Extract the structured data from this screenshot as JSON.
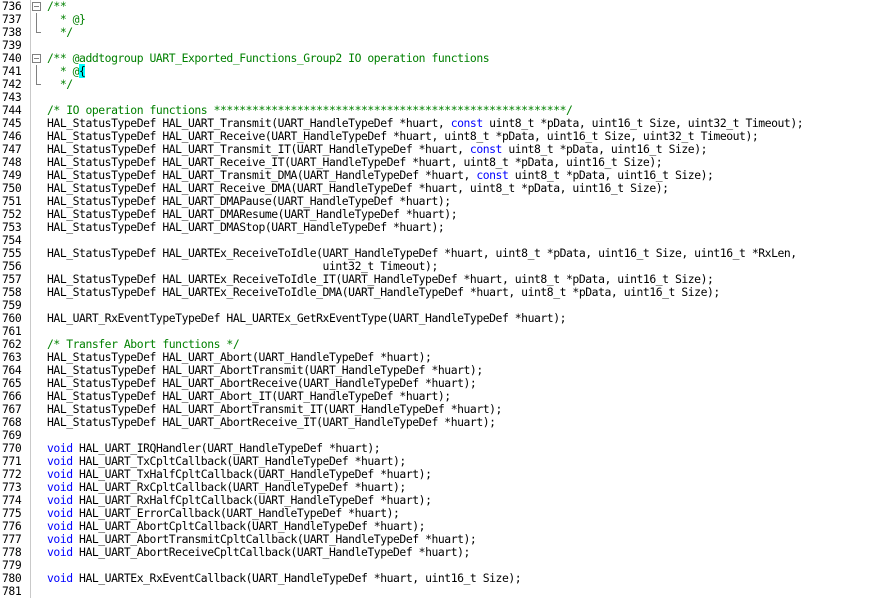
{
  "editor": {
    "lines": [
      {
        "n": "736",
        "fold": "start",
        "segs": [
          {
            "t": "/**",
            "c": "cmt"
          }
        ]
      },
      {
        "n": "737",
        "fold": "line",
        "segs": [
          {
            "t": "  * @}",
            "c": "cmt"
          }
        ]
      },
      {
        "n": "738",
        "fold": "end",
        "segs": [
          {
            "t": "  */",
            "c": "cmt"
          }
        ]
      },
      {
        "n": "739",
        "fold": "",
        "segs": []
      },
      {
        "n": "740",
        "fold": "start",
        "segs": [
          {
            "t": "/** @addtogroup UART_Exported_Functions_Group2 IO operation functions",
            "c": "cmt"
          }
        ]
      },
      {
        "n": "741",
        "fold": "line",
        "segs": [
          {
            "t": "  * @",
            "c": "cmt"
          },
          {
            "t": "{",
            "c": "cur"
          }
        ]
      },
      {
        "n": "742",
        "fold": "end",
        "segs": [
          {
            "t": "  */",
            "c": "cmt"
          }
        ]
      },
      {
        "n": "743",
        "fold": "",
        "segs": []
      },
      {
        "n": "744",
        "fold": "",
        "segs": [
          {
            "t": "/* IO operation functions *******************************************************/",
            "c": "cmt"
          }
        ]
      },
      {
        "n": "745",
        "fold": "",
        "segs": [
          {
            "t": "HAL_StatusTypeDef HAL_UART_Transmit(UART_HandleTypeDef *huart, ",
            "c": ""
          },
          {
            "t": "const",
            "c": "kw"
          },
          {
            "t": " uint8_t *pData, uint16_t Size, uint32_t Timeout);",
            "c": ""
          }
        ]
      },
      {
        "n": "746",
        "fold": "",
        "segs": [
          {
            "t": "HAL_StatusTypeDef HAL_UART_Receive(UART_HandleTypeDef *huart, uint8_t *pData, uint16_t Size, uint32_t Timeout);",
            "c": ""
          }
        ]
      },
      {
        "n": "747",
        "fold": "",
        "segs": [
          {
            "t": "HAL_StatusTypeDef HAL_UART_Transmit_IT(UART_HandleTypeDef *huart, ",
            "c": ""
          },
          {
            "t": "const",
            "c": "kw"
          },
          {
            "t": " uint8_t *pData, uint16_t Size);",
            "c": ""
          }
        ]
      },
      {
        "n": "748",
        "fold": "",
        "segs": [
          {
            "t": "HAL_StatusTypeDef HAL_UART_Receive_IT(UART_HandleTypeDef *huart, uint8_t *pData, uint16_t Size);",
            "c": ""
          }
        ]
      },
      {
        "n": "749",
        "fold": "",
        "segs": [
          {
            "t": "HAL_StatusTypeDef HAL_UART_Transmit_DMA(UART_HandleTypeDef *huart, ",
            "c": ""
          },
          {
            "t": "const",
            "c": "kw"
          },
          {
            "t": " uint8_t *pData, uint16_t Size);",
            "c": ""
          }
        ]
      },
      {
        "n": "750",
        "fold": "",
        "segs": [
          {
            "t": "HAL_StatusTypeDef HAL_UART_Receive_DMA(UART_HandleTypeDef *huart, uint8_t *pData, uint16_t Size);",
            "c": ""
          }
        ]
      },
      {
        "n": "751",
        "fold": "",
        "segs": [
          {
            "t": "HAL_StatusTypeDef HAL_UART_DMAPause(UART_HandleTypeDef *huart);",
            "c": ""
          }
        ]
      },
      {
        "n": "752",
        "fold": "",
        "segs": [
          {
            "t": "HAL_StatusTypeDef HAL_UART_DMAResume(UART_HandleTypeDef *huart);",
            "c": ""
          }
        ]
      },
      {
        "n": "753",
        "fold": "",
        "segs": [
          {
            "t": "HAL_StatusTypeDef HAL_UART_DMAStop(UART_HandleTypeDef *huart);",
            "c": ""
          }
        ]
      },
      {
        "n": "754",
        "fold": "",
        "segs": []
      },
      {
        "n": "755",
        "fold": "",
        "segs": [
          {
            "t": "HAL_StatusTypeDef HAL_UARTEx_ReceiveToIdle(UART_HandleTypeDef *huart, uint8_t *pData, uint16_t Size, uint16_t *RxLen,",
            "c": ""
          }
        ]
      },
      {
        "n": "756",
        "fold": "",
        "segs": [
          {
            "t": "                                           uint32_t Timeout);",
            "c": ""
          }
        ]
      },
      {
        "n": "757",
        "fold": "",
        "segs": [
          {
            "t": "HAL_StatusTypeDef HAL_UARTEx_ReceiveToIdle_IT(UART_HandleTypeDef *huart, uint8_t *pData, uint16_t Size);",
            "c": ""
          }
        ]
      },
      {
        "n": "758",
        "fold": "",
        "segs": [
          {
            "t": "HAL_StatusTypeDef HAL_UARTEx_ReceiveToIdle_DMA(UART_HandleTypeDef *huart, uint8_t *pData, uint16_t Size);",
            "c": ""
          }
        ]
      },
      {
        "n": "759",
        "fold": "",
        "segs": []
      },
      {
        "n": "760",
        "fold": "",
        "segs": [
          {
            "t": "HAL_UART_RxEventTypeTypeDef HAL_UARTEx_GetRxEventType(UART_HandleTypeDef *huart);",
            "c": ""
          }
        ]
      },
      {
        "n": "761",
        "fold": "",
        "segs": []
      },
      {
        "n": "762",
        "fold": "",
        "segs": [
          {
            "t": "/* Transfer Abort functions */",
            "c": "cmt"
          }
        ]
      },
      {
        "n": "763",
        "fold": "",
        "segs": [
          {
            "t": "HAL_StatusTypeDef HAL_UART_Abort(UART_HandleTypeDef *huart);",
            "c": ""
          }
        ]
      },
      {
        "n": "764",
        "fold": "",
        "segs": [
          {
            "t": "HAL_StatusTypeDef HAL_UART_AbortTransmit(UART_HandleTypeDef *huart);",
            "c": ""
          }
        ]
      },
      {
        "n": "765",
        "fold": "",
        "segs": [
          {
            "t": "HAL_StatusTypeDef HAL_UART_AbortReceive(UART_HandleTypeDef *huart);",
            "c": ""
          }
        ]
      },
      {
        "n": "766",
        "fold": "",
        "segs": [
          {
            "t": "HAL_StatusTypeDef HAL_UART_Abort_IT(UART_HandleTypeDef *huart);",
            "c": ""
          }
        ]
      },
      {
        "n": "767",
        "fold": "",
        "segs": [
          {
            "t": "HAL_StatusTypeDef HAL_UART_AbortTransmit_IT(UART_HandleTypeDef *huart);",
            "c": ""
          }
        ]
      },
      {
        "n": "768",
        "fold": "",
        "segs": [
          {
            "t": "HAL_StatusTypeDef HAL_UART_AbortReceive_IT(UART_HandleTypeDef *huart);",
            "c": ""
          }
        ]
      },
      {
        "n": "769",
        "fold": "",
        "segs": []
      },
      {
        "n": "770",
        "fold": "",
        "segs": [
          {
            "t": "void",
            "c": "kw"
          },
          {
            "t": " HAL_UART_IRQHandler(UART_HandleTypeDef *huart);",
            "c": ""
          }
        ]
      },
      {
        "n": "771",
        "fold": "",
        "segs": [
          {
            "t": "void",
            "c": "kw"
          },
          {
            "t": " HAL_UART_TxCpltCallback(UART_HandleTypeDef *huart);",
            "c": ""
          }
        ]
      },
      {
        "n": "772",
        "fold": "",
        "segs": [
          {
            "t": "void",
            "c": "kw"
          },
          {
            "t": " HAL_UART_TxHalfCpltCallback(UART_HandleTypeDef *huart);",
            "c": ""
          }
        ]
      },
      {
        "n": "773",
        "fold": "",
        "segs": [
          {
            "t": "void",
            "c": "kw"
          },
          {
            "t": " HAL_UART_RxCpltCallback(UART_HandleTypeDef *huart);",
            "c": ""
          }
        ]
      },
      {
        "n": "774",
        "fold": "",
        "segs": [
          {
            "t": "void",
            "c": "kw"
          },
          {
            "t": " HAL_UART_RxHalfCpltCallback(UART_HandleTypeDef *huart);",
            "c": ""
          }
        ]
      },
      {
        "n": "775",
        "fold": "",
        "segs": [
          {
            "t": "void",
            "c": "kw"
          },
          {
            "t": " HAL_UART_ErrorCallback(UART_HandleTypeDef *huart);",
            "c": ""
          }
        ]
      },
      {
        "n": "776",
        "fold": "",
        "segs": [
          {
            "t": "void",
            "c": "kw"
          },
          {
            "t": " HAL_UART_AbortCpltCallback(UART_HandleTypeDef *huart);",
            "c": ""
          }
        ]
      },
      {
        "n": "777",
        "fold": "",
        "segs": [
          {
            "t": "void",
            "c": "kw"
          },
          {
            "t": " HAL_UART_AbortTransmitCpltCallback(UART_HandleTypeDef *huart);",
            "c": ""
          }
        ]
      },
      {
        "n": "778",
        "fold": "",
        "segs": [
          {
            "t": "void",
            "c": "kw"
          },
          {
            "t": " HAL_UART_AbortReceiveCpltCallback(UART_HandleTypeDef *huart);",
            "c": ""
          }
        ]
      },
      {
        "n": "779",
        "fold": "",
        "segs": []
      },
      {
        "n": "780",
        "fold": "",
        "segs": [
          {
            "t": "void",
            "c": "kw"
          },
          {
            "t": " HAL_UARTEx_RxEventCallback(UART_HandleTypeDef *huart, uint16_t Size);",
            "c": ""
          }
        ]
      },
      {
        "n": "781",
        "fold": "",
        "segs": []
      }
    ]
  },
  "colors": {
    "comment": "#008000",
    "keyword": "#0000ff",
    "text": "#000000",
    "cursor_highlight": "#00ffff",
    "background": "#ffffff"
  }
}
